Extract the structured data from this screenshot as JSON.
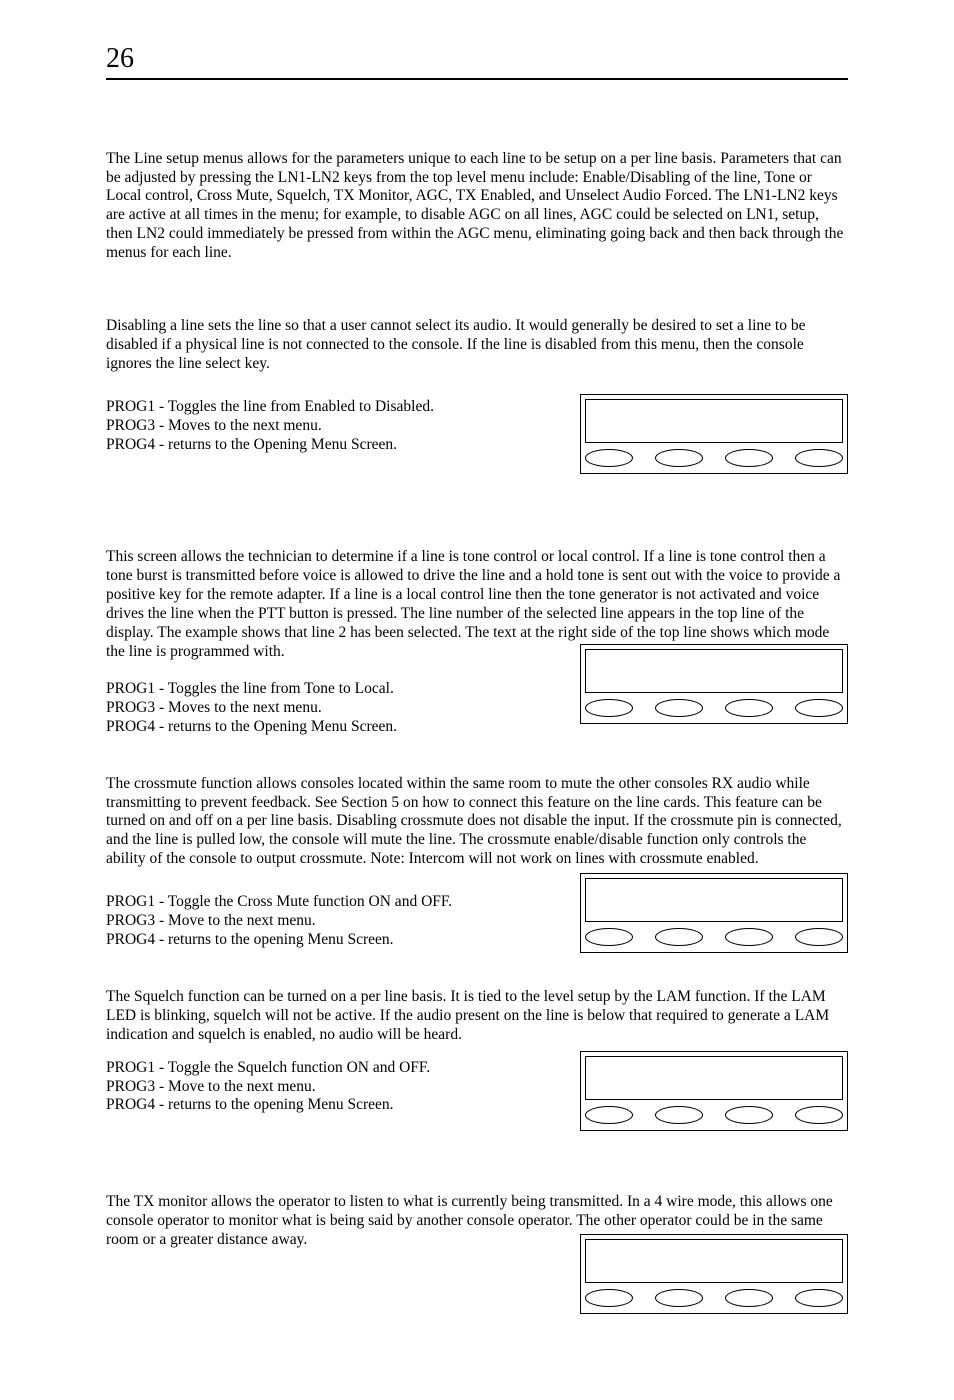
{
  "page_number": "26",
  "intro": "The Line setup menus allows for the parameters unique to each line to be setup on a per line basis.  Parameters that can be adjusted by pressing the LN1-LN2 keys from the top level menu include: Enable/Disabling of the line, Tone or Local control, Cross Mute, Squelch, TX Monitor, AGC, TX Enabled, and Unselect Audio Forced.  The LN1-LN2 keys are active at all times in the menu; for example, to disable AGC on all lines, AGC could be selected on LN1, setup, then LN2 could immediately be pressed from within the AGC menu, eliminating going back and then back through the menus for each line.",
  "disable": {
    "text": "Disabling a line sets the line so that a user cannot select its audio.  It  would generally be desired to set a line to be disabled if a physical line is not connected to the console.  If the line is disabled from this menu, then the console ignores the line select key.",
    "prog1": "PROG1 - Toggles the line from Enabled to Disabled.",
    "prog3": "PROG3 - Moves to the next menu.",
    "prog4": "PROG4 - returns to the Opening Menu Screen."
  },
  "tone": {
    "text": "This screen allows the technician to determine if a line is tone control or local control.  If a line is tone control then a tone burst is transmitted before voice is allowed to drive the line and a hold tone is sent out with the voice to provide a positive key for the remote adapter.  If a line is a local control line then the tone generator is not activated and voice drives the line when the PTT button is pressed.  The line number of the selected line appears in the top line of the display.  The example shows that line 2 has been selected.  The text at the right side of the top line shows which mode the line is programmed with.",
    "prog1": "PROG1 - Toggles the line from Tone to Local.",
    "prog3": "PROG3 - Moves to the next menu.",
    "prog4": "PROG4 - returns to the Opening Menu Screen."
  },
  "crossmute": {
    "text": "The crossmute function allows consoles located within the same room to mute the other consoles RX audio while transmitting to prevent feedback.  See Section 5 on how to connect this feature on the line cards.  This feature can be turned on and off on a per line basis.  Disabling crossmute does not disable the input.  If the crossmute pin is connected, and the line is pulled low, the console will mute the line.  The crossmute enable/disable function only controls the ability of the console to output crossmute.  Note:  Intercom will not work on lines with crossmute enabled.",
    "prog1": "PROG1 - Toggle the Cross Mute function ON and OFF.",
    "prog3": "PROG3 - Move to the next menu.",
    "prog4": "PROG4 - returns to the opening Menu Screen."
  },
  "squelch": {
    "text": "The Squelch function can be turned on a per line basis.  It is tied to the level setup by the LAM function.  If the LAM LED is blinking, squelch will not be active.  If the audio present on the line is below that required to generate a LAM indication and squelch is enabled, no audio will be heard.",
    "prog1": "PROG1 - Toggle the Squelch function ON and OFF.",
    "prog3": "PROG3 - Move to the next menu.",
    "prog4": "PROG4 - returns to the opening Menu Screen."
  },
  "txmon": {
    "text": "The TX monitor allows the operator to listen to what is currently being transmitted.  In a 4 wire mode, this allows one console operator to monitor what is being said by another console operator.  The other operator could be in the same room or a greater distance away."
  }
}
